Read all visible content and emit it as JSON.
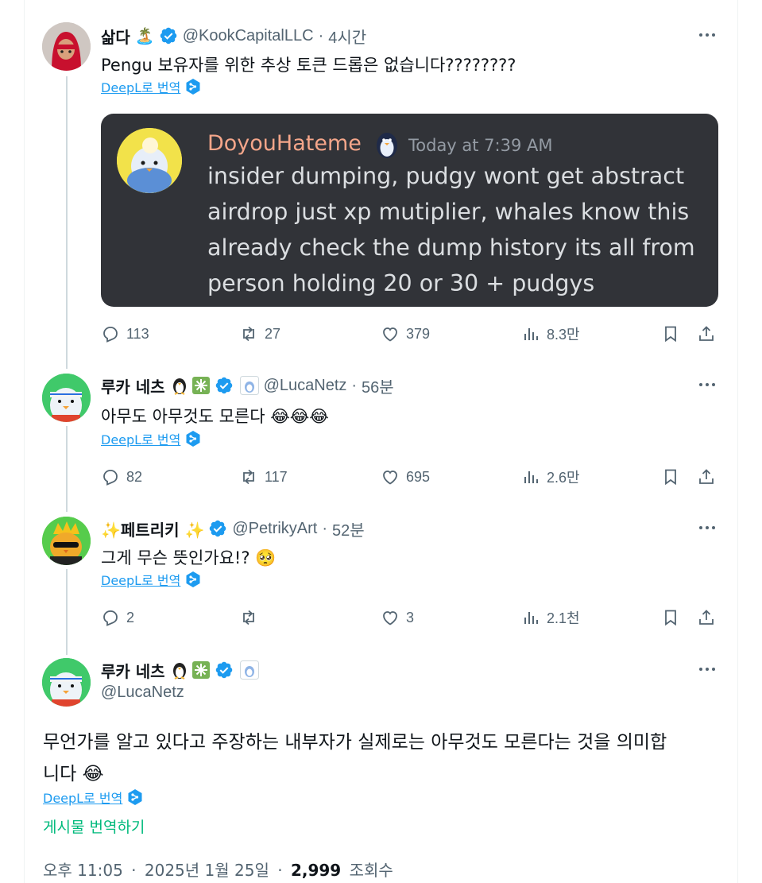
{
  "posts": [
    {
      "name": "삶다",
      "name_emoji": "🏝️",
      "handle": "@KookCapitalLLC",
      "separator": "·",
      "time": "4시간",
      "text": "Pengu 보유자를 위한 추상 토큰 드롭은 없습니다????????",
      "deepl_label": "DeepL로 번역",
      "replies": "113",
      "reposts": "27",
      "likes": "379",
      "views": "8.3만"
    },
    {
      "name": "루카 네츠",
      "handle": "@LucaNetz",
      "separator": "·",
      "time": "56분",
      "text": "아무도 아무것도 모른다 😂😂😂",
      "deepl_label": "DeepL로 번역",
      "replies": "82",
      "reposts": "117",
      "likes": "695",
      "views": "2.6만"
    },
    {
      "name": "✨페트리키 ✨",
      "handle": "@PetrikyArt",
      "separator": "·",
      "time": "52분",
      "text": "그게 무슨 뜻인가요!? 🥺",
      "deepl_label": "DeepL로 번역",
      "replies": "2",
      "reposts": "",
      "likes": "3",
      "views": "2.1천"
    }
  ],
  "embed": {
    "username": "DoyouHateme",
    "timestamp": "Today at 7:39 AM",
    "lines": [
      "insider dumping, pudgy wont get abstract",
      "airdrop just xp mutiplier, whales know this",
      "already check the dump history its all from",
      "person holding 20 or 30 + pudgys"
    ]
  },
  "main_post": {
    "name": "루카 네츠",
    "handle": "@LucaNetz",
    "text_line1": "무언가를 알고 있다고 주장하는 내부자가 실제로는 아무것도 모른다는 것을 의미합",
    "text_line2": "니다 😂",
    "deepl_label": "DeepL로 번역",
    "translate_post": "게시물 번역하기",
    "time": "오후 11:05",
    "date": "2025년 1월 25일",
    "views_count": "2,999",
    "views_label": "조회수",
    "separator": "·"
  },
  "colors": {
    "verified": "#1d9bf0",
    "link": "#1d9bf0",
    "translate": "#00ba7c",
    "muted": "#536471",
    "embed_bg": "#313338"
  },
  "icons": [
    "reply-icon",
    "repost-icon",
    "like-icon",
    "views-icon",
    "bookmark-icon",
    "share-icon",
    "verified-icon",
    "more-icon",
    "deepl-icon"
  ]
}
